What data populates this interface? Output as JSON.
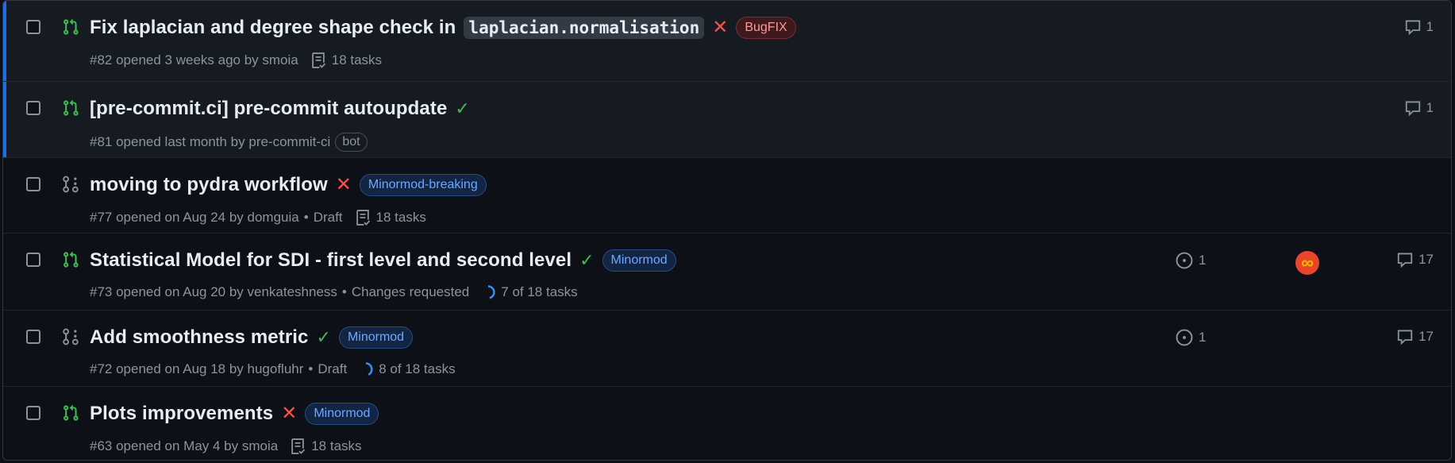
{
  "rows": [
    {
      "title": "Fix laplacian and degree shape check in",
      "code": "laplacian.normalisation",
      "label": "BugFIX",
      "meta": "#82 opened 3 weeks ago by smoia",
      "tasks": "18 tasks",
      "comments": "1"
    },
    {
      "title": "[pre-commit.ci] pre-commit autoupdate",
      "meta": "#81 opened last month by pre-commit-ci",
      "badge": "bot",
      "comments": "1"
    },
    {
      "title": "moving to pydra workflow",
      "label": "Minormod-breaking",
      "meta": "#77 opened on Aug 24 by domguia",
      "sep": "•",
      "draft": "Draft",
      "tasks": "18 tasks"
    },
    {
      "title": "Statistical Model for SDI - first level and second level",
      "label": "Minormod",
      "meta": "#73 opened on Aug 20 by venkateshness",
      "sep": "•",
      "review": "Changes requested",
      "tasks": "7 of 18 tasks",
      "tasks_progress": 0.39,
      "issues": "1",
      "comments": "17"
    },
    {
      "title": "Add smoothness metric",
      "label": "Minormod",
      "meta": "#72 opened on Aug 18 by hugofluhr",
      "sep": "•",
      "draft": "Draft",
      "tasks": "8 of 18 tasks",
      "tasks_progress": 0.44,
      "issues": "1",
      "comments": "17"
    },
    {
      "title": "Plots improvements",
      "label": "Minormod",
      "meta": "#63 opened on May 4 by smoia",
      "tasks": "18 tasks"
    }
  ],
  "colors": {
    "open_pr": "#3fb950",
    "draft_pr": "#8b949e",
    "fail": "#f85149",
    "pass": "#3fb950",
    "accent": "#1f6feb"
  },
  "icons": {
    "open": "git-pull-request-icon",
    "draft": "git-pull-request-draft-icon",
    "tasks": "tasklist-icon",
    "comment": "comment-icon",
    "issue": "issue-opened-icon",
    "avatar_glyph": "∞"
  }
}
